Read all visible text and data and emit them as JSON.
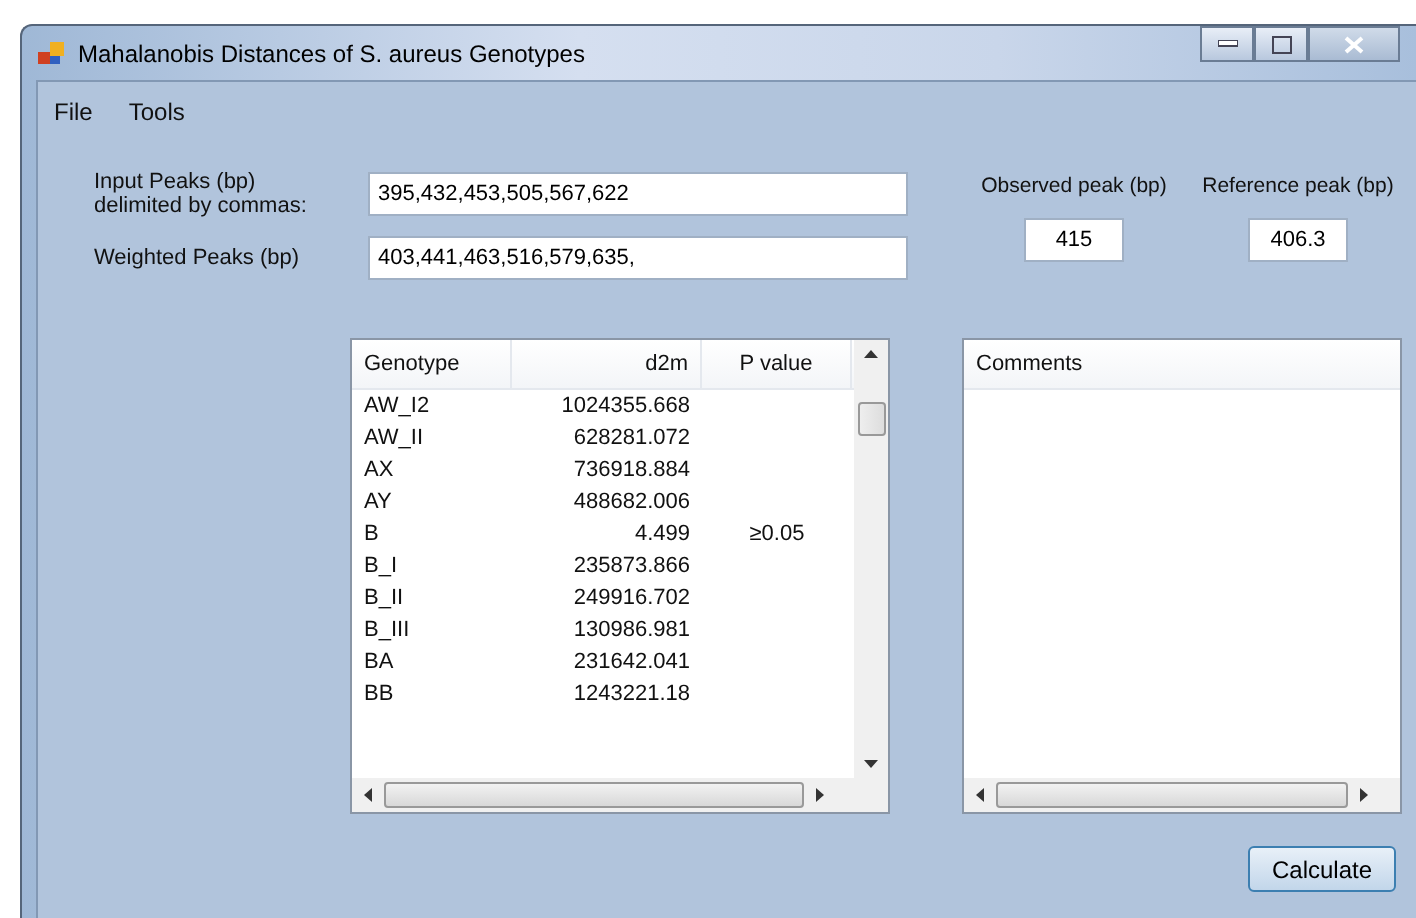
{
  "window": {
    "title": "Mahalanobis Distances of S. aureus Genotypes"
  },
  "menu": [
    "File",
    "Tools"
  ],
  "inputs": [
    {
      "label": "Input Peaks (bp)\ndelimited by commas:",
      "value": "395,432,453,505,567,622"
    },
    {
      "label": "Weighted Peaks (bp)",
      "value": "403,441,463,516,579,635,"
    }
  ],
  "peaks": [
    {
      "label": "Observed peak (bp)",
      "value": "415"
    },
    {
      "label": "Reference peak (bp)",
      "value": "406.3"
    }
  ],
  "table": {
    "columns": [
      "Genotype",
      "d2m",
      "P value"
    ],
    "rows": [
      [
        "AW_I2",
        "1024355.668",
        ""
      ],
      [
        "AW_II",
        "628281.072",
        ""
      ],
      [
        "AX",
        "736918.884",
        ""
      ],
      [
        "AY",
        "488682.006",
        ""
      ],
      [
        "B",
        "4.499",
        "≥0.05"
      ],
      [
        "B_I",
        "235873.866",
        ""
      ],
      [
        "B_II",
        "249916.702",
        ""
      ],
      [
        "B_III",
        "130986.981",
        ""
      ],
      [
        "BA",
        "231642.041",
        ""
      ],
      [
        "BB",
        "1243221.18",
        ""
      ]
    ]
  },
  "comments": {
    "columns": [
      "Comments"
    ]
  },
  "buttons": [
    "Calculate"
  ]
}
